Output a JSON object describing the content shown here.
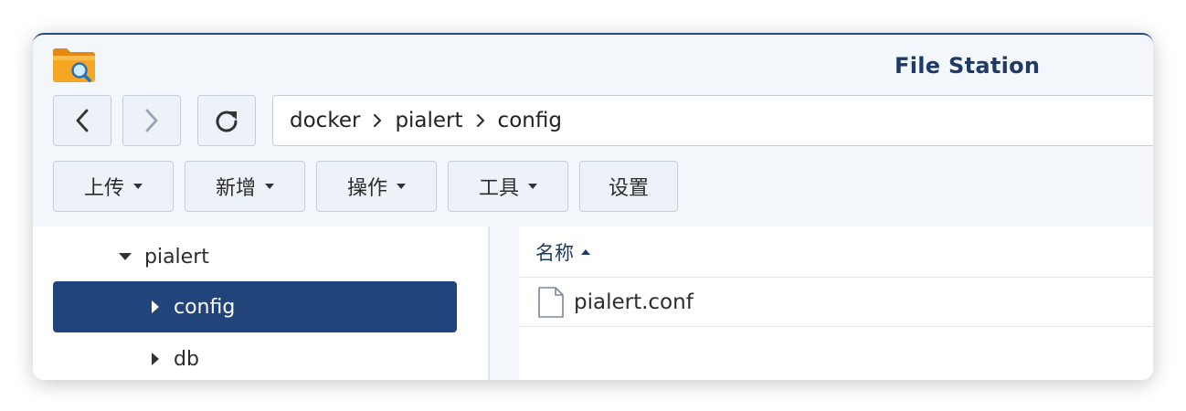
{
  "app": {
    "title": "File Station",
    "icon": "file-station-folder-icon"
  },
  "navigation": {
    "back_icon": "chevron-left-icon",
    "forward_icon": "chevron-right-icon",
    "refresh_icon": "refresh-icon",
    "path": [
      "docker",
      "pialert",
      "config"
    ]
  },
  "toolbar": {
    "upload_label": "上传",
    "create_label": "新增",
    "action_label": "操作",
    "tools_label": "工具",
    "settings_label": "设置"
  },
  "tree": {
    "items": [
      {
        "label": "pialert",
        "expanded": true
      },
      {
        "label": "config",
        "selected": true
      },
      {
        "label": "db"
      }
    ]
  },
  "file_list": {
    "columns": [
      {
        "label": "名称",
        "sort": "ascending"
      }
    ],
    "rows": [
      {
        "name": "pialert.conf",
        "icon": "document-icon"
      }
    ]
  },
  "colors": {
    "accent": "#21447a",
    "title": "#1e3a66",
    "window_bg": "#f3f6fb",
    "button_bg": "#edf2f9",
    "border": "#c3cedd"
  }
}
